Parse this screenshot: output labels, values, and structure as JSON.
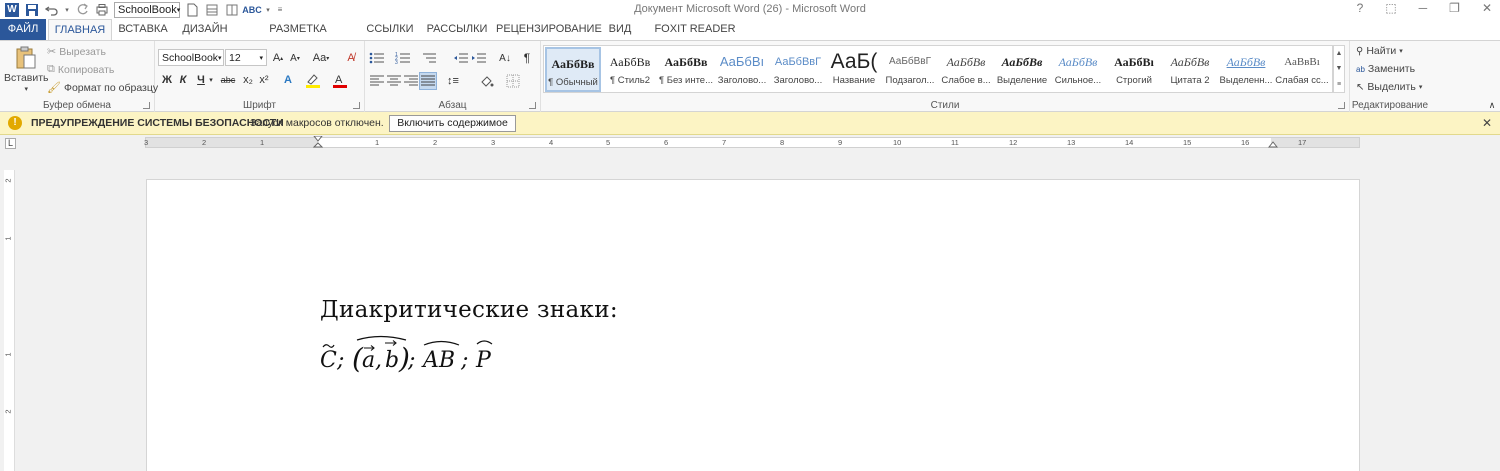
{
  "window": {
    "title": "Документ Microsoft Word (26) - Microsoft Word",
    "controls": [
      "?",
      "⬚",
      "─",
      "❐",
      "✕"
    ]
  },
  "qat": {
    "font": "SchoolBook"
  },
  "tabs": [
    "ФАЙЛ",
    "ГЛАВНАЯ",
    "ВСТАВКА",
    "ДИЗАЙН",
    "РАЗМЕТКА СТРАНИЦЫ",
    "ССЫЛКИ",
    "РАССЫЛКИ",
    "РЕЦЕНЗИРОВАНИЕ",
    "ВИД",
    "FOXIT READER PDF"
  ],
  "clipboard": {
    "label": "Буфер обмена",
    "paste": "Вставить",
    "cut": "Вырезать",
    "copy": "Копировать",
    "format_painter": "Формат по образцу"
  },
  "font": {
    "label": "Шрифт",
    "name": "SchoolBook",
    "size": "12",
    "case": "Aa",
    "bold": "Ж",
    "italic": "К",
    "underline": "Ч",
    "strike": "abc",
    "sub": "x₂",
    "sup": "x²"
  },
  "paragraph": {
    "label": "Абзац",
    "pilcrow": "¶"
  },
  "styles": {
    "label": "Стили",
    "items": [
      {
        "preview": "АаБбВв",
        "name": "¶ Обычный"
      },
      {
        "preview": "АаБбВв",
        "name": "¶ Стиль2"
      },
      {
        "preview": "АаБбВв",
        "name": "¶ Без инте..."
      },
      {
        "preview": "АаБбВı",
        "name": "Заголово..."
      },
      {
        "preview": "АаБбВвГ",
        "name": "Заголово..."
      },
      {
        "preview": "АаБ(",
        "name": "Название"
      },
      {
        "preview": "АаБбВвГ",
        "name": "Подзагол..."
      },
      {
        "preview": "АаБбВв",
        "name": "Слабое в..."
      },
      {
        "preview": "АаБбВв",
        "name": "Выделение"
      },
      {
        "preview": "АаБбВв",
        "name": "Сильное..."
      },
      {
        "preview": "АаБбВı",
        "name": "Строгий"
      },
      {
        "preview": "АаБбВв",
        "name": "Цитата 2"
      },
      {
        "preview": "АаБбВв",
        "name": "Выделенн..."
      },
      {
        "preview": "АаВвВı",
        "name": "Слабая сс..."
      }
    ]
  },
  "editing": {
    "label": "Редактирование",
    "find": "Найти",
    "replace": "Заменить",
    "select": "Выделить"
  },
  "security": {
    "title": "ПРЕДУПРЕЖДЕНИЕ СИСТЕМЫ БЕЗОПАСНОСТИ",
    "message": "Запуск макросов отключен.",
    "button": "Включить содержимое"
  },
  "ruler": {
    "labels": [
      "3",
      "2",
      "1",
      "1",
      "2",
      "3",
      "4",
      "5",
      "6",
      "7",
      "8",
      "9",
      "10",
      "11",
      "12",
      "13",
      "14",
      "15",
      "16",
      "17"
    ],
    "vertical": [
      "2",
      "1",
      "1",
      "2"
    ]
  },
  "document": {
    "heading": "Диакритические знаки:",
    "formula": {
      "c": "C",
      "a": "a",
      "b": "b",
      "ab": "AB",
      "p": "P",
      "sep": ";",
      "comma": ","
    }
  }
}
